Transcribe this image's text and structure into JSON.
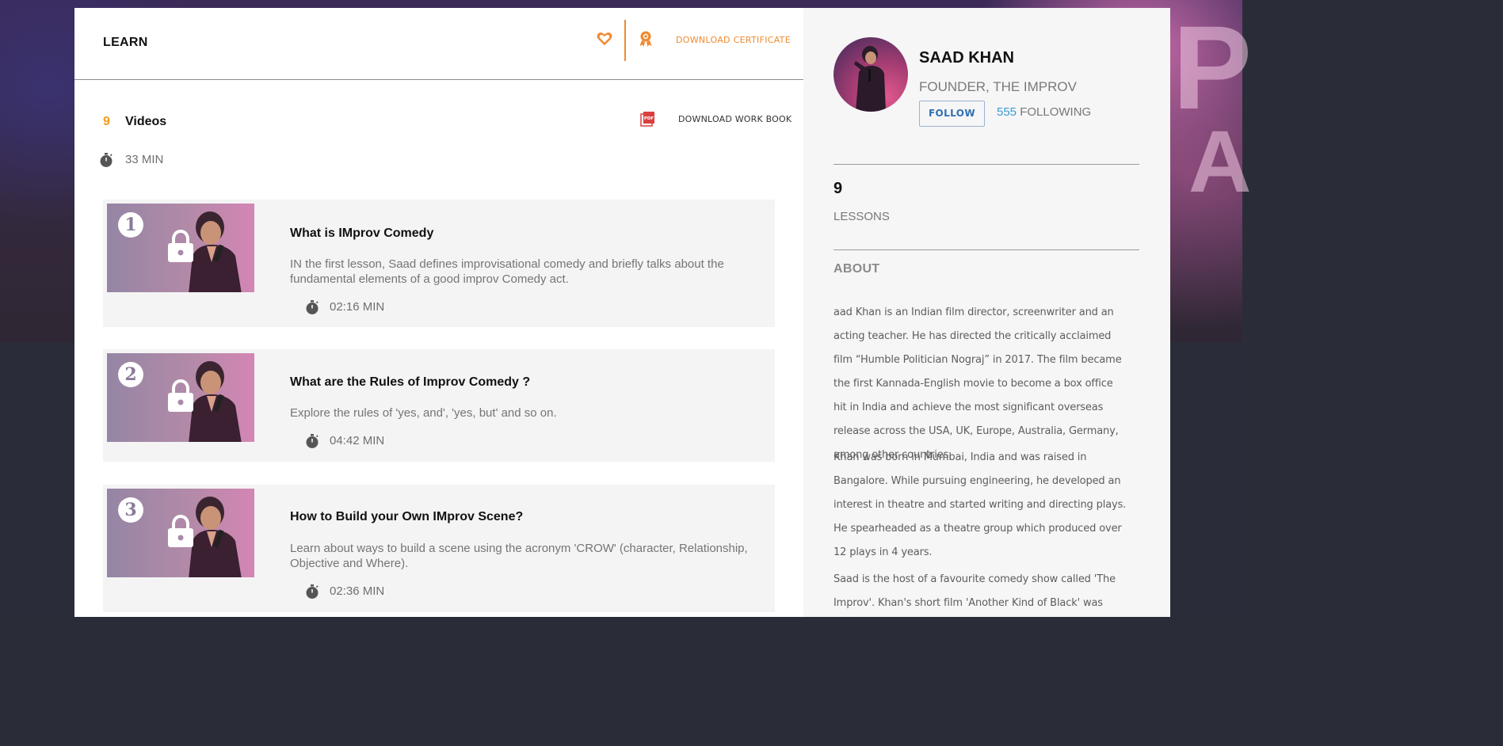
{
  "header": {
    "title": "LEARN",
    "favorite_icon": "heart-icon",
    "certificate_icon": "award-ribbon-icon",
    "download_certificate": "DOWNLOAD CERTIFICATE"
  },
  "course": {
    "video_count": "9",
    "videos_label": "Videos",
    "total_duration": "33 MIN",
    "download_workbook": "DOWNLOAD WORK BOOK",
    "workbook_icon": "pdf-icon"
  },
  "lessons": [
    {
      "number": "1",
      "title": "What is IMprov Comedy",
      "description": "IN the first lesson, Saad defines improvisational comedy and briefly talks about the fundamental elements of a good improv Comedy act.",
      "duration": "02:16 MIN"
    },
    {
      "number": "2",
      "title": "What are the Rules of Improv Comedy ?",
      "description": "Explore the rules of 'yes, and', 'yes, but' and so on.",
      "duration": "04:42 MIN"
    },
    {
      "number": "3",
      "title": "How to Build your Own IMprov Scene?",
      "description": "Learn about ways to build a scene using the acronym 'CROW' (character, Relationship, Objective and Where).",
      "duration": "02:36 MIN"
    }
  ],
  "author": {
    "name": "SAAD KHAN",
    "role": "FOUNDER, THE IMPROV",
    "follow_label": "FOLLOW",
    "following_count": "555",
    "following_label": "FOLLOWING",
    "lessons_count": "9",
    "lessons_label": "LESSONS",
    "about_title": "ABOUT",
    "about_paragraphs": [
      "aad Khan is an Indian film director, screenwriter and an acting teacher. He has directed the critically acclaimed film “Humble Politician Nograj” in 2017. The film became the first Kannada-English movie to become a box office hit in India and achieve the most significant overseas release across the USA, UK, Europe, Australia, Germany, among other countries.",
      "Khan was born in Mumbai, India and was raised in Bangalore. While pursuing engineering, he developed an interest in theatre and started writing and directing plays. He spearheaded as a theatre group which produced over 12 plays in 4 years.",
      "Saad is the host of a favourite comedy show called 'The Improv'. Khan's short film 'Another Kind of Black' was"
    ]
  },
  "colors": {
    "accent_orange": "#f08a30",
    "count_orange": "#f29b1d",
    "follow_blue": "#2f6fb5",
    "following_blue": "#3a9ad9"
  }
}
